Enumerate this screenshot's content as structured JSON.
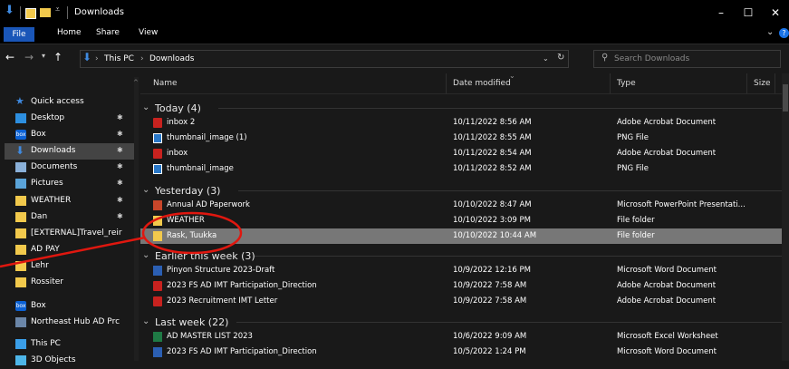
{
  "window": {
    "title": "Downloads",
    "controls": [
      "–",
      "☐",
      "✕"
    ]
  },
  "ribbon": {
    "tabs": [
      "File",
      "Home",
      "Share",
      "View"
    ]
  },
  "address": {
    "path": [
      "This PC",
      "Downloads"
    ],
    "search_placeholder": "Search Downloads"
  },
  "columns": [
    "Name",
    "Date modified",
    "Type",
    "Size"
  ],
  "nav": {
    "items": [
      {
        "label": "Quick access",
        "icon": "star-icon",
        "pinned": false
      },
      {
        "label": "Desktop",
        "icon": "desktop-icon",
        "pinned": true
      },
      {
        "label": "Box",
        "icon": "box-icon",
        "pinned": true
      },
      {
        "label": "Downloads",
        "icon": "download-icon",
        "pinned": true
      },
      {
        "label": "Documents",
        "icon": "documents-icon",
        "pinned": true
      },
      {
        "label": "Pictures",
        "icon": "pictures-icon",
        "pinned": true
      },
      {
        "label": "WEATHER",
        "icon": "folder-icon",
        "pinned": true
      },
      {
        "label": "Dan",
        "icon": "folder-icon",
        "pinned": true
      },
      {
        "label": "[EXTERNAL]Travel_reir",
        "icon": "folder-icon",
        "pinned": false
      },
      {
        "label": "AD PAY",
        "icon": "folder-icon",
        "pinned": false
      },
      {
        "label": "Lehr",
        "icon": "folder-icon",
        "pinned": false
      },
      {
        "label": "Rossiter",
        "icon": "folder-icon",
        "pinned": false
      },
      {
        "label": "Box",
        "icon": "box-icon",
        "pinned": false
      },
      {
        "label": "Northeast Hub AD Prc",
        "icon": "hub-icon",
        "pinned": false
      },
      {
        "label": "This PC",
        "icon": "pc-icon",
        "pinned": false
      },
      {
        "label": "3D Objects",
        "icon": "3d-objects-icon",
        "pinned": false
      }
    ]
  },
  "groups": [
    {
      "label": "Today (4)",
      "rows": [
        {
          "name": "inbox 2",
          "date": "10/11/2022 8:56 AM",
          "type": "Adobe Acrobat Document",
          "icon": "pdf-icon"
        },
        {
          "name": "thumbnail_image (1)",
          "date": "10/11/2022 8:55 AM",
          "type": "PNG File",
          "icon": "image-icon"
        },
        {
          "name": "inbox",
          "date": "10/11/2022 8:54 AM",
          "type": "Adobe Acrobat Document",
          "icon": "pdf-icon"
        },
        {
          "name": "thumbnail_image",
          "date": "10/11/2022 8:52 AM",
          "type": "PNG File",
          "icon": "image-icon"
        }
      ]
    },
    {
      "label": "Yesterday (3)",
      "rows": [
        {
          "name": "Annual AD Paperwork",
          "date": "10/10/2022 8:47 AM",
          "type": "Microsoft PowerPoint Presentati...",
          "icon": "powerpoint-icon"
        },
        {
          "name": "WEATHER",
          "date": "10/10/2022 3:09 PM",
          "type": "File folder",
          "icon": "folder-icon"
        },
        {
          "name": "Rask, Tuukka",
          "date": "10/10/2022 10:44 AM",
          "type": "File folder",
          "icon": "folder-icon",
          "selected": true
        }
      ]
    },
    {
      "label": "Earlier this week (3)",
      "rows": [
        {
          "name": "Pinyon Structure 2023-Draft",
          "date": "10/9/2022 12:16 PM",
          "type": "Microsoft Word Document",
          "icon": "word-icon"
        },
        {
          "name": "2023 FS AD IMT Participation_Direction",
          "date": "10/9/2022 7:58 AM",
          "type": "Adobe Acrobat Document",
          "icon": "pdf-icon"
        },
        {
          "name": "2023 Recruitment IMT Letter",
          "date": "10/9/2022 7:58 AM",
          "type": "Adobe Acrobat Document",
          "icon": "pdf-icon"
        }
      ]
    },
    {
      "label": "Last week (22)",
      "rows": [
        {
          "name": "AD MASTER LIST 2023",
          "date": "10/6/2022 9:09 AM",
          "type": "Microsoft Excel Worksheet",
          "icon": "excel-icon"
        },
        {
          "name": "2023 FS AD IMT Participation_Direction",
          "date": "10/5/2022 1:24 PM",
          "type": "Microsoft Word Document",
          "icon": "word-icon"
        }
      ]
    }
  ],
  "colors": {
    "background": "#191919",
    "selection": "#777777",
    "annotation": "#e0170f",
    "file_tab": "#1a56b8"
  }
}
